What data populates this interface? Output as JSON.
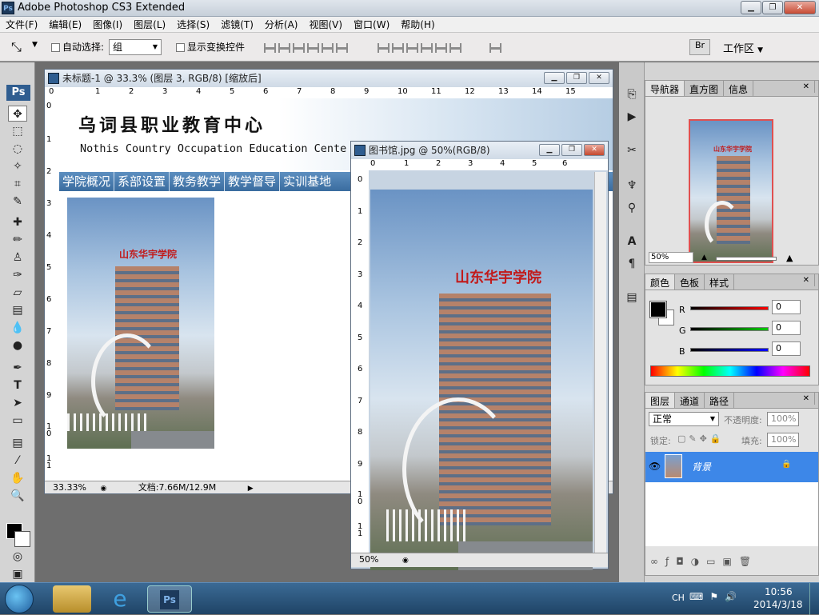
{
  "window": {
    "title": "Adobe Photoshop CS3 Extended",
    "logo": "Ps"
  },
  "menu": [
    "文件(F)",
    "编辑(E)",
    "图像(I)",
    "图层(L)",
    "选择(S)",
    "滤镜(T)",
    "分析(A)",
    "视图(V)",
    "窗口(W)",
    "帮助(H)"
  ],
  "options": {
    "auto_select_label": "自动选择:",
    "auto_select_value": "组",
    "show_transform_label": "显示变换控件",
    "workspace_label": "工作区"
  },
  "toolbox": {
    "logo": "Ps"
  },
  "doc1": {
    "title": "未标题-1 @ 33.3% (图层 3, RGB/8) [缩放后]",
    "ruler_x": [
      "0",
      "1",
      "2",
      "3",
      "4",
      "5",
      "6",
      "7",
      "8",
      "9",
      "10",
      "11",
      "12",
      "13",
      "14",
      "15"
    ],
    "ruler_y": [
      "0",
      "1",
      "2",
      "3",
      "4",
      "5",
      "6",
      "7",
      "8",
      "9",
      "1 0",
      "1 1"
    ],
    "heading_cn": "乌词县职业教育中心",
    "heading_en": "Nothis Country Occupation Education Cente",
    "nav": [
      "学院概况",
      "系部设置",
      "教务教学",
      "教学督导",
      "实训基地"
    ],
    "photo_sign": "山东华宇学院",
    "zoom": "33.33%",
    "docsize": "文档:7.66M/12.9M"
  },
  "doc2": {
    "title": "图书馆.jpg @ 50%(RGB/8)",
    "ruler_x": [
      "0",
      "1",
      "2",
      "3",
      "4",
      "5",
      "6"
    ],
    "ruler_y": [
      "0",
      "1",
      "2",
      "3",
      "4",
      "5",
      "6",
      "7",
      "8",
      "9",
      "1 0",
      "1 1"
    ],
    "photo_sign": "山东华宇学院",
    "zoom": "50%"
  },
  "navigator": {
    "tabs": [
      "导航器",
      "直方图",
      "信息"
    ],
    "zoom": "50%",
    "photo_sign": "山东华宇学院"
  },
  "color": {
    "tabs": [
      "颜色",
      "色板",
      "样式"
    ],
    "channels": [
      {
        "label": "R",
        "value": "0",
        "color": "#d42020"
      },
      {
        "label": "G",
        "value": "0",
        "color": "#20b020"
      },
      {
        "label": "B",
        "value": "0",
        "color": "#2020d0"
      }
    ]
  },
  "layers": {
    "tabs": [
      "图层",
      "通道",
      "路径"
    ],
    "blend_mode": "正常",
    "opacity_label": "不透明度:",
    "opacity": "100%",
    "lock_label": "锁定:",
    "fill_label": "填充:",
    "fill": "100%",
    "layer_name": "背景"
  },
  "taskbar": {
    "lang": "CH",
    "time": "10:56",
    "date": "2014/3/18",
    "ps_label": "Ps"
  }
}
